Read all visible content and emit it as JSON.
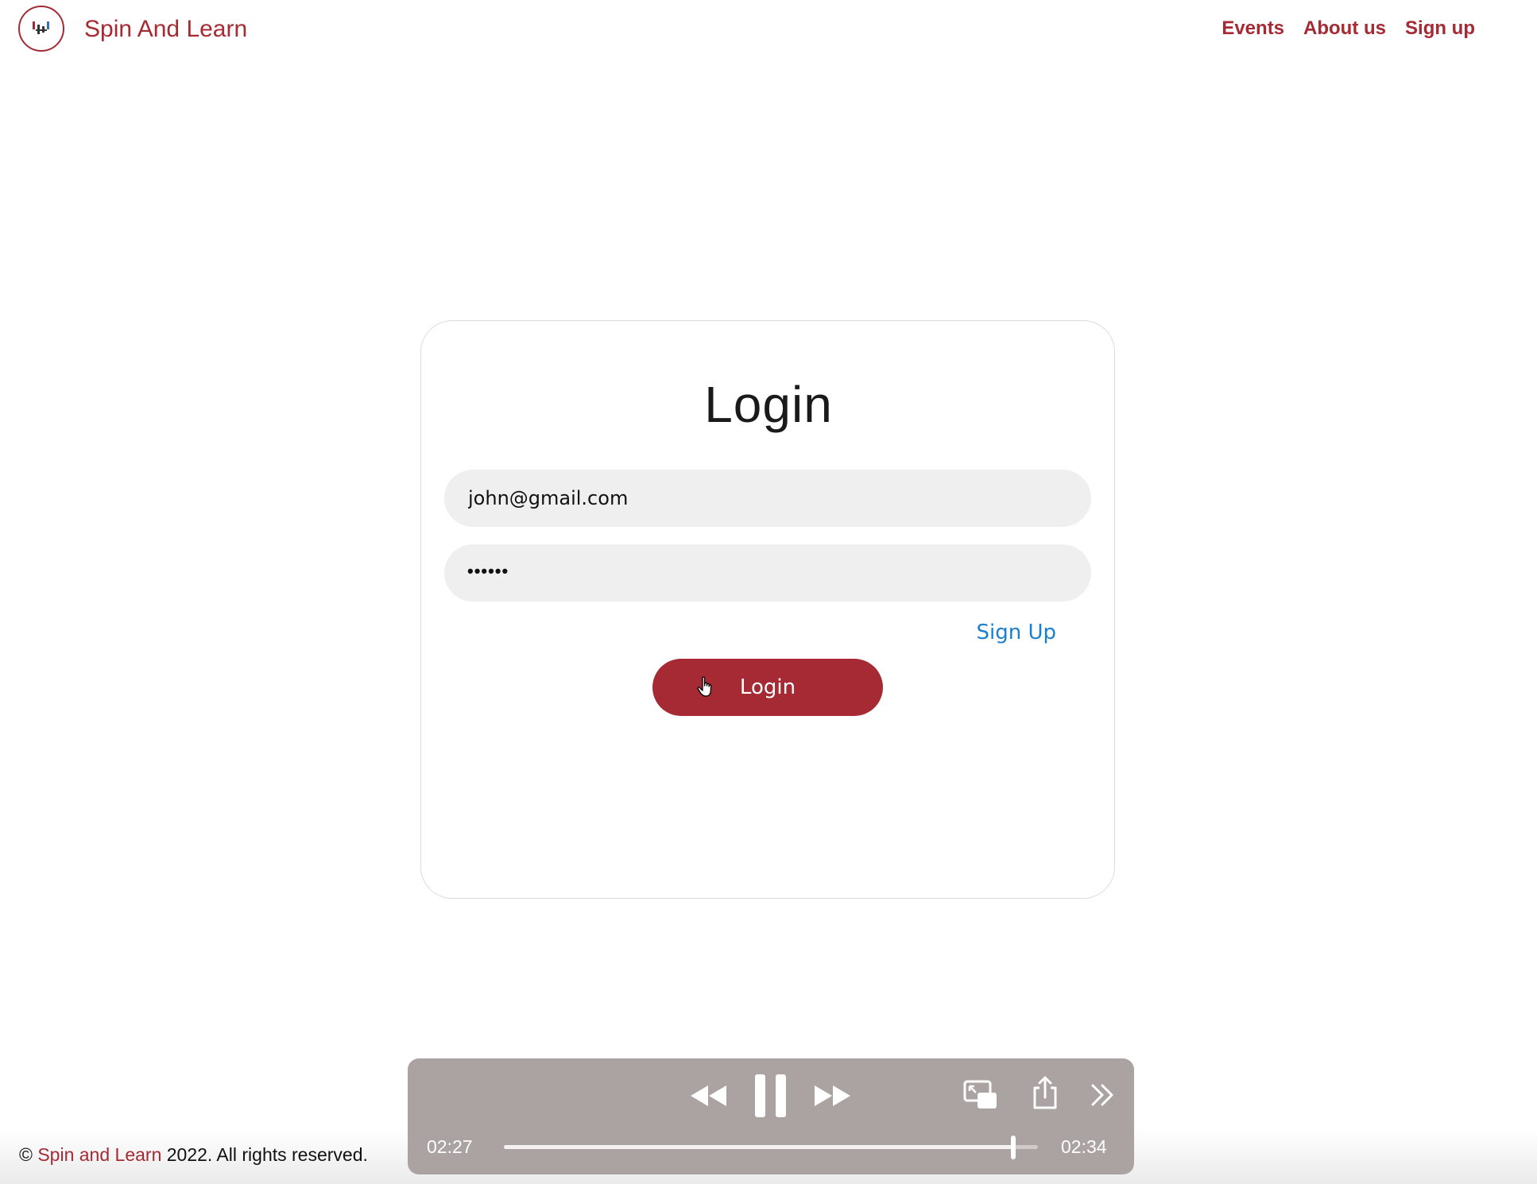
{
  "header": {
    "brand": "Spin And Learn",
    "logo_icon": "dj-turntable-icon",
    "nav": [
      {
        "label": "Events"
      },
      {
        "label": "About us"
      },
      {
        "label": "Sign up"
      }
    ]
  },
  "login": {
    "title": "Login",
    "email_value": "john@gmail.com",
    "password_mask": "••••••",
    "signup_link": "Sign Up",
    "button_label": "Login"
  },
  "footer": {
    "copyright_symbol": "©",
    "brand_link": "Spin and Learn",
    "rest": "2022. All rights reserved."
  },
  "player": {
    "current_time": "02:27",
    "total_time": "02:34",
    "progress": 0.954,
    "icons": [
      "rewind-icon",
      "pause-icon",
      "fast-forward-icon",
      "picture-in-picture-icon",
      "share-icon",
      "more-chevrons-icon"
    ]
  },
  "colors": {
    "brand": "#a52a33",
    "link": "#1a7fd1",
    "field_bg": "#efefef",
    "player_bg": "#aaa3a1"
  }
}
